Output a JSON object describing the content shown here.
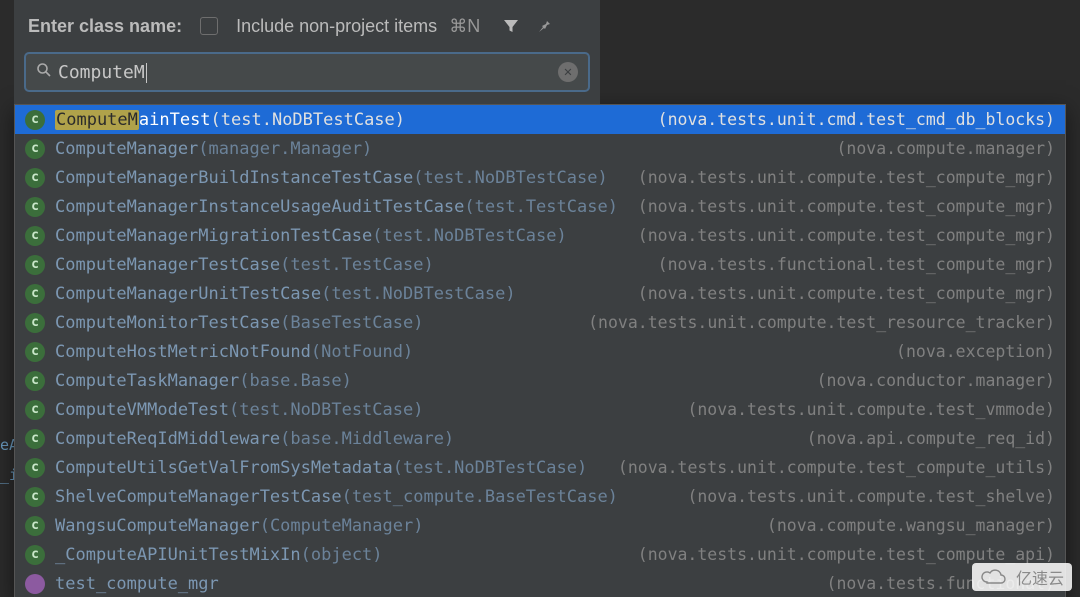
{
  "header": {
    "title": "Enter class name:",
    "checkbox_label": "Include non-project items",
    "checkbox_checked": false,
    "shortcut": "⌘N"
  },
  "search": {
    "query": "ComputeM"
  },
  "selected_highlight": "ComputeM",
  "results": [
    {
      "icon": "c",
      "selected": true,
      "name": "ComputeMainTest",
      "params": "(test.NoDBTestCase)",
      "location": "(nova.tests.unit.cmd.test_cmd_db_blocks)"
    },
    {
      "icon": "c",
      "selected": false,
      "name": "ComputeManager",
      "params": "(manager.Manager)",
      "location": "(nova.compute.manager)"
    },
    {
      "icon": "c",
      "selected": false,
      "name": "ComputeManagerBuildInstanceTestCase",
      "params": "(test.NoDBTestCase)",
      "location": "(nova.tests.unit.compute.test_compute_mgr)"
    },
    {
      "icon": "c",
      "selected": false,
      "name": "ComputeManagerInstanceUsageAuditTestCase",
      "params": "(test.TestCase)",
      "location": "(nova.tests.unit.compute.test_compute_mgr)"
    },
    {
      "icon": "c",
      "selected": false,
      "name": "ComputeManagerMigrationTestCase",
      "params": "(test.NoDBTestCase)",
      "location": "(nova.tests.unit.compute.test_compute_mgr)"
    },
    {
      "icon": "c",
      "selected": false,
      "name": "ComputeManagerTestCase",
      "params": "(test.TestCase)",
      "location": "(nova.tests.functional.test_compute_mgr)"
    },
    {
      "icon": "c",
      "selected": false,
      "name": "ComputeManagerUnitTestCase",
      "params": "(test.NoDBTestCase)",
      "location": "(nova.tests.unit.compute.test_compute_mgr)"
    },
    {
      "icon": "c",
      "selected": false,
      "name": "ComputeMonitorTestCase",
      "params": "(BaseTestCase)",
      "location": "(nova.tests.unit.compute.test_resource_tracker)"
    },
    {
      "icon": "c",
      "selected": false,
      "name": "ComputeHostMetricNotFound",
      "params": "(NotFound)",
      "location": "(nova.exception)"
    },
    {
      "icon": "c",
      "selected": false,
      "name": "ComputeTaskManager",
      "params": "(base.Base)",
      "location": "(nova.conductor.manager)"
    },
    {
      "icon": "c",
      "selected": false,
      "name": "ComputeVMModeTest",
      "params": "(test.NoDBTestCase)",
      "location": "(nova.tests.unit.compute.test_vmmode)"
    },
    {
      "icon": "c",
      "selected": false,
      "name": "ComputeReqIdMiddleware",
      "params": "(base.Middleware)",
      "location": "(nova.api.compute_req_id)"
    },
    {
      "icon": "c",
      "selected": false,
      "name": "ComputeUtilsGetValFromSysMetadata",
      "params": "(test.NoDBTestCase)",
      "location": "(nova.tests.unit.compute.test_compute_utils)"
    },
    {
      "icon": "c",
      "selected": false,
      "name": "ShelveComputeManagerTestCase",
      "params": "(test_compute.BaseTestCase)",
      "location": "(nova.tests.unit.compute.test_shelve)"
    },
    {
      "icon": "c",
      "selected": false,
      "name": "WangsuComputeManager",
      "params": "(ComputeManager)",
      "location": "(nova.compute.wangsu_manager)"
    },
    {
      "icon": "c",
      "selected": false,
      "name": "_ComputeAPIUnitTestMixIn",
      "params": "(object)",
      "location": "(nova.tests.unit.compute.test_compute_api)"
    },
    {
      "icon": "v",
      "selected": false,
      "name": "test_compute_mgr",
      "params": "",
      "location": "(nova.tests.functional)"
    }
  ],
  "bg_code": {
    "line1": "eA",
    "line2": "_i"
  },
  "watermark": "亿速云"
}
